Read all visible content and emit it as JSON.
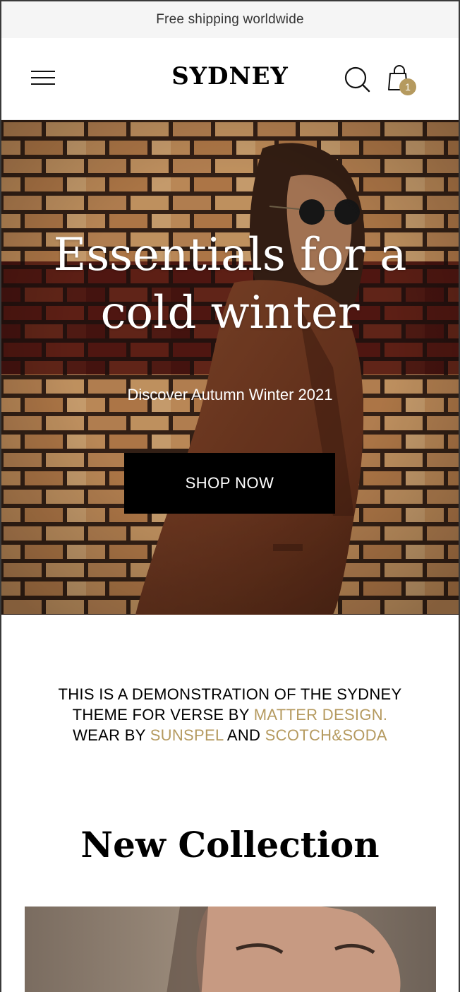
{
  "announcement": {
    "text": "Free shipping worldwide"
  },
  "header": {
    "logo": "SYDNEY",
    "cart_count": "1",
    "icons": {
      "menu": "hamburger-menu-icon",
      "search": "search-icon",
      "cart": "shopping-bag-icon"
    }
  },
  "hero": {
    "title_line1": "Essentials for a",
    "title_line2": "cold winter",
    "subtitle": "Discover Autumn Winter 2021",
    "cta_label": "SHOP NOW"
  },
  "intro": {
    "line1": "THIS IS A DEMONSTRATION OF THE SYDNEY",
    "line2_prefix": "THEME FOR VERSE BY ",
    "line2_link": "MATTER DESIGN.",
    "line3_prefix": "WEAR BY ",
    "line3_link1": "SUNSPEL",
    "line3_mid": " AND ",
    "line3_link2": "SCOTCH&SODA"
  },
  "collection": {
    "title": "New Collection"
  },
  "colors": {
    "accent": "#b59a5f",
    "announcement_bg": "#f5f5f5",
    "button_bg": "#000000"
  }
}
